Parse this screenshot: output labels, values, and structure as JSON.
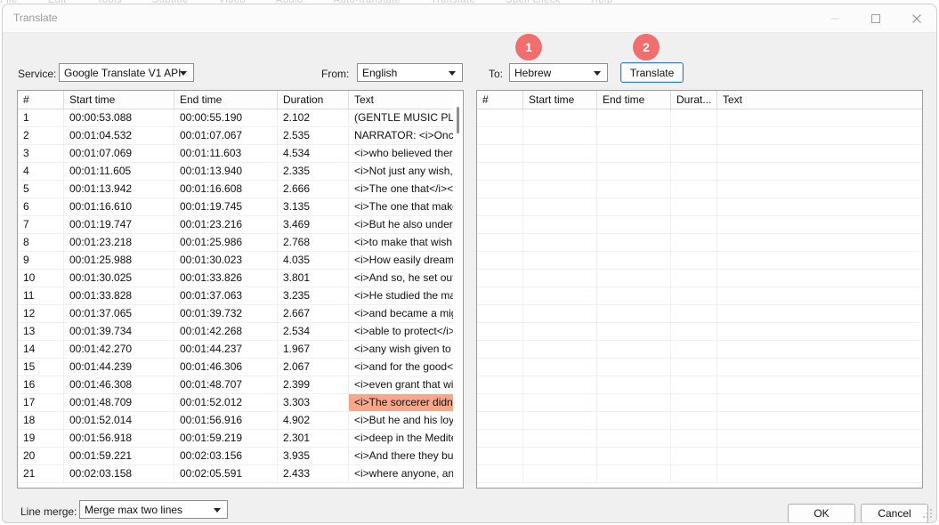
{
  "background_strip": {
    "fragments": [
      "File",
      "Edit",
      "Tools",
      "Subtitle",
      "Video",
      "Audio",
      "Auto-translate",
      "Translate",
      "Spell check",
      "Help"
    ]
  },
  "window": {
    "title": "Translate",
    "minimize_icon": "minimize-icon",
    "maximize_icon": "maximize-icon",
    "close_icon": "close-icon"
  },
  "toolbar": {
    "service_label": "Service:",
    "service_value": "Google Translate V1 API",
    "from_label": "From:",
    "from_value": "English",
    "to_label": "To:",
    "to_value": "Hebrew",
    "translate_label": "Translate"
  },
  "badges": [
    {
      "number": "1",
      "color": "#ef6f6f"
    },
    {
      "number": "2",
      "color": "#ef6f6f"
    }
  ],
  "source_table": {
    "columns": [
      "#",
      "Start time",
      "End time",
      "Duration",
      "Text"
    ],
    "selected_index": 16,
    "rows": [
      {
        "num": "1",
        "start": "00:00:53.088",
        "end": "00:00:55.190",
        "dur": "2.102",
        "text": "(GENTLE MUSIC PLAYI..."
      },
      {
        "num": "2",
        "start": "00:01:04.532",
        "end": "00:01:07.067",
        "dur": "2.535",
        "text": "NARRATOR: <i>Once ..."
      },
      {
        "num": "3",
        "start": "00:01:07.069",
        "end": "00:01:11.603",
        "dur": "4.534",
        "text": "<i>who believed there..."
      },
      {
        "num": "4",
        "start": "00:01:11.605",
        "end": "00:01:13.940",
        "dur": "2.335",
        "text": "<i>Not just any wish,<..."
      },
      {
        "num": "5",
        "start": "00:01:13.942",
        "end": "00:01:16.608",
        "dur": "2.666",
        "text": "<i>The one that</i><..."
      },
      {
        "num": "6",
        "start": "00:01:16.610",
        "end": "00:01:19.745",
        "dur": "3.135",
        "text": "<i>The one that make..."
      },
      {
        "num": "7",
        "start": "00:01:19.747",
        "end": "00:01:23.216",
        "dur": "3.469",
        "text": "<i>But he also underst..."
      },
      {
        "num": "8",
        "start": "00:01:23.218",
        "end": "00:01:25.986",
        "dur": "2.768",
        "text": "<i>to make that wish c..."
      },
      {
        "num": "9",
        "start": "00:01:25.988",
        "end": "00:01:30.023",
        "dur": "4.035",
        "text": "<i>How easily dreams..."
      },
      {
        "num": "10",
        "start": "00:01:30.025",
        "end": "00:01:33.826",
        "dur": "3.801",
        "text": "<i>And so, he set out..."
      },
      {
        "num": "11",
        "start": "00:01:33.828",
        "end": "00:01:37.063",
        "dur": "3.235",
        "text": "<i>He studied the mag..."
      },
      {
        "num": "12",
        "start": "00:01:37.065",
        "end": "00:01:39.732",
        "dur": "2.667",
        "text": "<i>and became a mig..."
      },
      {
        "num": "13",
        "start": "00:01:39.734",
        "end": "00:01:42.268",
        "dur": "2.534",
        "text": "<i>able to protect</i>..."
      },
      {
        "num": "14",
        "start": "00:01:42.270",
        "end": "00:01:44.237",
        "dur": "1.967",
        "text": "<i>any wish given to h..."
      },
      {
        "num": "15",
        "start": "00:01:44.239",
        "end": "00:01:46.306",
        "dur": "2.067",
        "text": "<i>and for the good</i..."
      },
      {
        "num": "16",
        "start": "00:01:46.308",
        "end": "00:01:48.707",
        "dur": "2.399",
        "text": "<i>even grant that wis..."
      },
      {
        "num": "17",
        "start": "00:01:48.709",
        "end": "00:01:52.012",
        "dur": "3.303",
        "text": "<i>The sorcerer didn't..."
      },
      {
        "num": "18",
        "start": "00:01:52.014",
        "end": "00:01:56.916",
        "dur": "4.902",
        "text": "<i>But he and his loyal..."
      },
      {
        "num": "19",
        "start": "00:01:56.918",
        "end": "00:01:59.219",
        "dur": "2.301",
        "text": "<i>deep in the Mediter..."
      },
      {
        "num": "20",
        "start": "00:01:59.221",
        "end": "00:02:03.156",
        "dur": "3.935",
        "text": "<i>And there they built..."
      },
      {
        "num": "21",
        "start": "00:02:03.158",
        "end": "00:02:05.591",
        "dur": "2.433",
        "text": "<i>where anyone, any..."
      }
    ]
  },
  "target_table": {
    "columns": [
      "#",
      "Start time",
      "End time",
      "Durat...",
      "Text"
    ],
    "rows": []
  },
  "footer": {
    "line_merge_label": "Line merge:",
    "line_merge_value": "Merge max two lines",
    "ok_label": "OK",
    "cancel_label": "Cancel"
  },
  "colors": {
    "selection": "#f7a68a",
    "badge": "#ef6f6f",
    "focus_border": "#2a7fd4",
    "dialog_bg": "#f0f0f0"
  }
}
